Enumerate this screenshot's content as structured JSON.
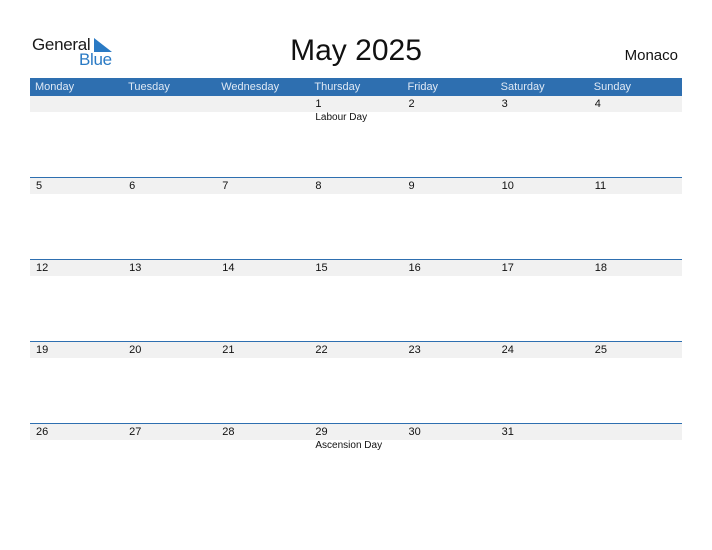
{
  "logo": {
    "line1": "General",
    "line2": "Blue"
  },
  "title": "May 2025",
  "country": "Monaco",
  "colors": {
    "header_bg": "#2e6fb0",
    "accent": "#2a7ac4",
    "band": "#f1f1f1"
  },
  "weekdays": [
    "Monday",
    "Tuesday",
    "Wednesday",
    "Thursday",
    "Friday",
    "Saturday",
    "Sunday"
  ],
  "weeks": [
    [
      {
        "day": ""
      },
      {
        "day": ""
      },
      {
        "day": ""
      },
      {
        "day": "1",
        "holiday": "Labour Day"
      },
      {
        "day": "2"
      },
      {
        "day": "3"
      },
      {
        "day": "4"
      }
    ],
    [
      {
        "day": "5"
      },
      {
        "day": "6"
      },
      {
        "day": "7"
      },
      {
        "day": "8"
      },
      {
        "day": "9"
      },
      {
        "day": "10"
      },
      {
        "day": "11"
      }
    ],
    [
      {
        "day": "12"
      },
      {
        "day": "13"
      },
      {
        "day": "14"
      },
      {
        "day": "15"
      },
      {
        "day": "16"
      },
      {
        "day": "17"
      },
      {
        "day": "18"
      }
    ],
    [
      {
        "day": "19"
      },
      {
        "day": "20"
      },
      {
        "day": "21"
      },
      {
        "day": "22"
      },
      {
        "day": "23"
      },
      {
        "day": "24"
      },
      {
        "day": "25"
      }
    ],
    [
      {
        "day": "26"
      },
      {
        "day": "27"
      },
      {
        "day": "28"
      },
      {
        "day": "29",
        "holiday": "Ascension Day"
      },
      {
        "day": "30"
      },
      {
        "day": "31"
      },
      {
        "day": ""
      }
    ]
  ]
}
